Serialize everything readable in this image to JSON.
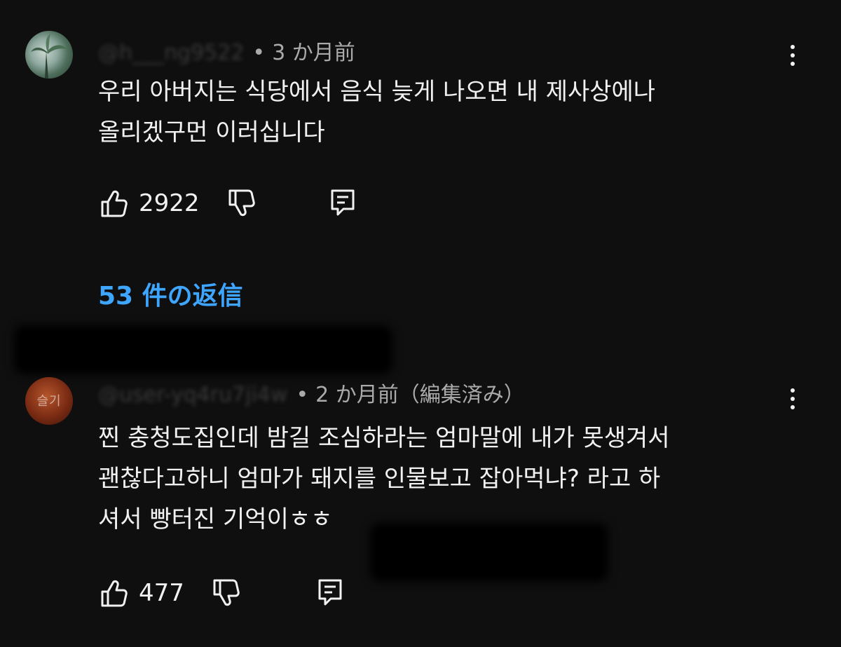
{
  "comments": [
    {
      "handle": "@h___ng9522",
      "time": "3 か月前",
      "body_lines": [
        "우리 아버지는 식당에서 음식 늦게 나오면 내 제사상에나",
        "올리겠구먼 이러십니다"
      ],
      "likes": "2922",
      "avatar_icon": "photo-avatar"
    },
    {
      "handle": "@user-yq4ru7ji4w",
      "time": "2 か月前（編集済み）",
      "avatar_text": "슬기",
      "body_lines": [
        "찐 충청도집인데 밤길 조심하라는 엄마말에 내가 못생겨서",
        "괜찮다고하니 엄마가 돼지를 인물보고 잡아먹냐? 라고 하",
        "셔서 빵터진 기억이ㅎㅎ"
      ],
      "likes": "477",
      "avatar_icon": "text-avatar"
    }
  ],
  "replies_label": "53 件の返信",
  "colors": {
    "background": "#0f0f0f",
    "text": "#f1f1f1",
    "secondary": "#aaaaaa",
    "link": "#3ea6ff"
  },
  "icons": [
    "like-icon",
    "dislike-icon",
    "reply-icon",
    "more-vert-icon"
  ]
}
